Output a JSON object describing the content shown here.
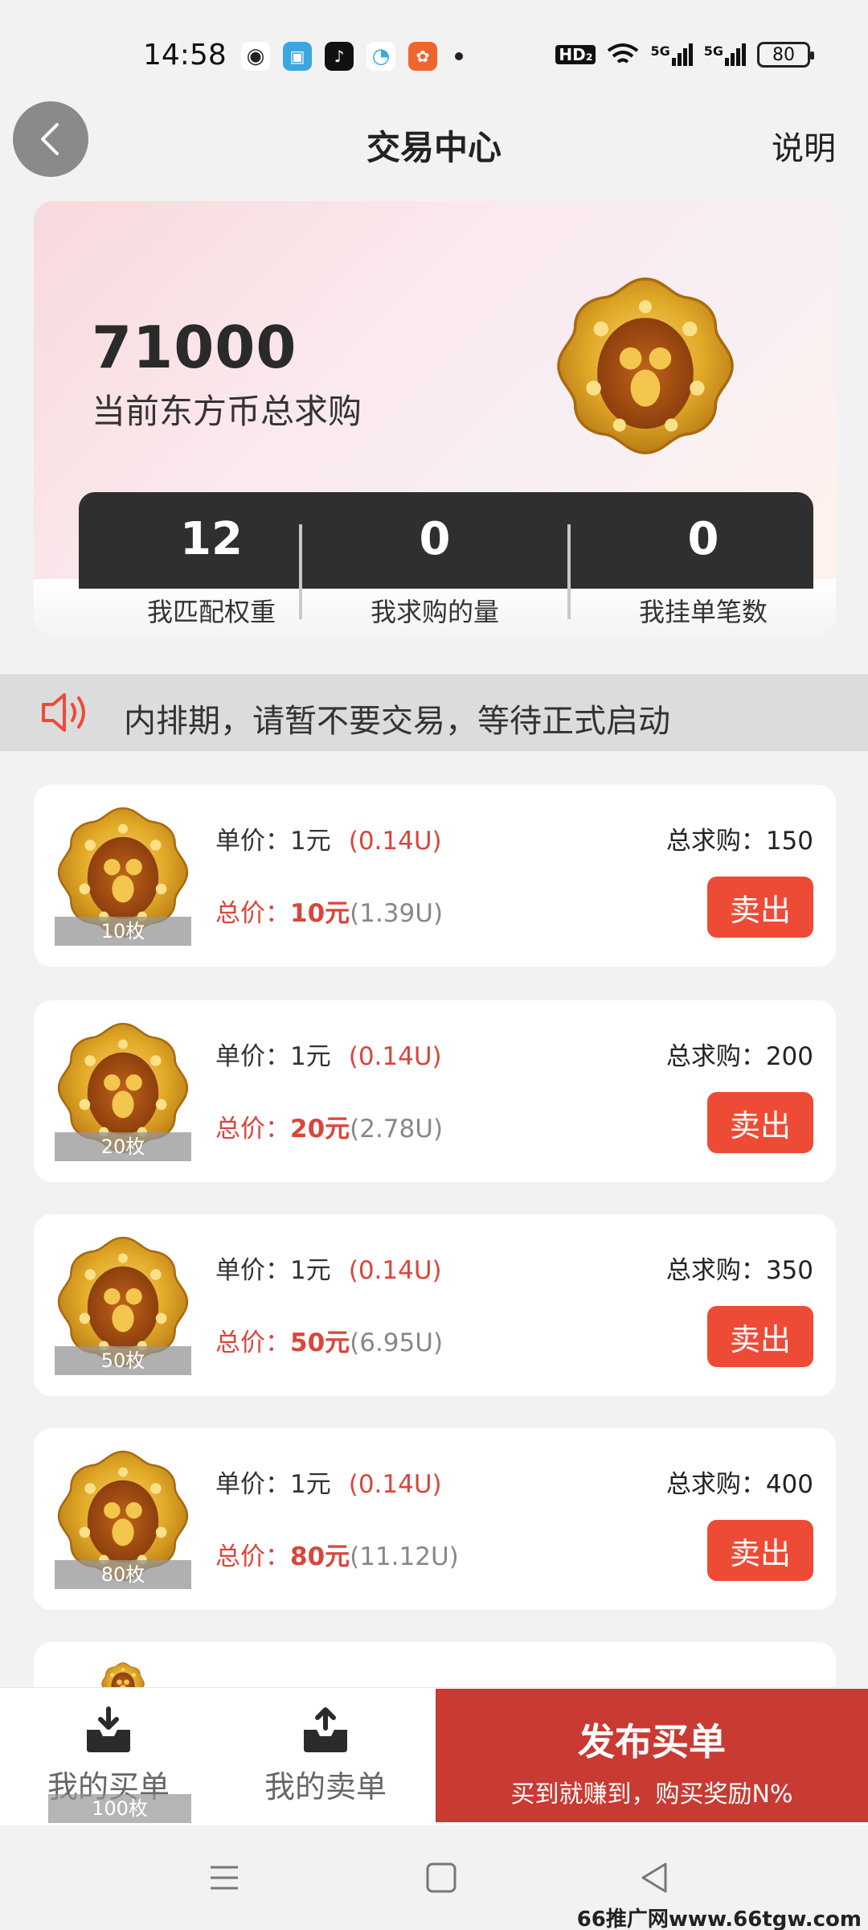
{
  "status_bar": {
    "time": "14:58",
    "network": "HD₂",
    "signal1": "5G",
    "signal2": "5G",
    "battery": "80",
    "icons": [
      "wechat-icon",
      "app-icon",
      "tiktok-icon",
      "browser-icon",
      "app-store-icon"
    ]
  },
  "header": {
    "title": "交易中心",
    "help": "说明"
  },
  "summary": {
    "total_demand": "71000",
    "total_demand_label": "当前东方币总求购",
    "stats": [
      {
        "value": "12",
        "label": "我匹配权重"
      },
      {
        "value": "0",
        "label": "我求购的量"
      },
      {
        "value": "0",
        "label": "我挂单笔数"
      }
    ]
  },
  "notice": {
    "text": "内排期，请暂不要交易，等待正式启动"
  },
  "listings": [
    {
      "qty": "10枚",
      "unit_label": "单价：",
      "unit_price": "1元",
      "unit_usdt": "(0.14U)",
      "total_label": "总价：",
      "total_value": "10元",
      "total_usdt": "(1.39U)",
      "demand": "总求购：150",
      "sell": "卖出"
    },
    {
      "qty": "20枚",
      "unit_label": "单价：",
      "unit_price": "1元",
      "unit_usdt": "(0.14U)",
      "total_label": "总价：",
      "total_value": "20元",
      "total_usdt": "(2.78U)",
      "demand": "总求购：200",
      "sell": "卖出"
    },
    {
      "qty": "50枚",
      "unit_label": "单价：",
      "unit_price": "1元",
      "unit_usdt": "(0.14U)",
      "total_label": "总价：",
      "total_value": "50元",
      "total_usdt": "(6.95U)",
      "demand": "总求购：350",
      "sell": "卖出"
    },
    {
      "qty": "80枚",
      "unit_label": "单价：",
      "unit_price": "1元",
      "unit_usdt": "(0.14U)",
      "total_label": "总价：",
      "total_value": "80元",
      "total_usdt": "(11.12U)",
      "demand": "总求购：400",
      "sell": "卖出"
    }
  ],
  "bottom": {
    "my_buy": "我的买单",
    "my_sell": "我的卖单",
    "overlay_qty": "100枚",
    "publish_title": "发布买单",
    "publish_sub": "买到就赚到，购买奖励N%"
  },
  "watermark": "66推广网www.66tgw.com",
  "colors": {
    "accent_red": "#ee4b37",
    "publish_red": "#c93a32",
    "price_red": "#d9463b",
    "dark_bar": "#2f2f31"
  }
}
